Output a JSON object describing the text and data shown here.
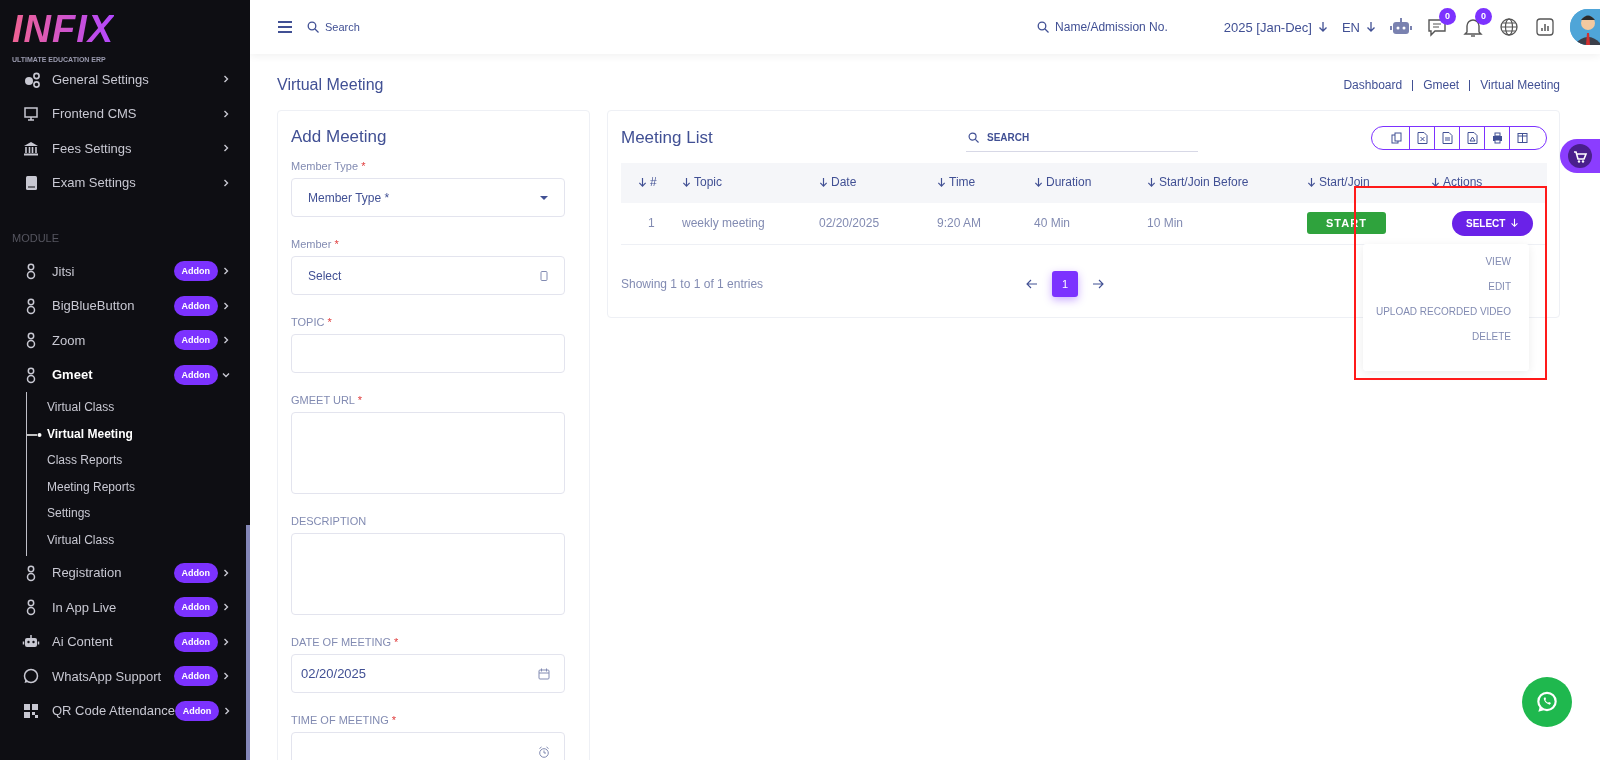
{
  "brand": {
    "logo": "INFIX",
    "tagline": "ULTIMATE EDUCATION ERP"
  },
  "sidebar": {
    "items": [
      {
        "label": "General Settings",
        "expanded": false
      },
      {
        "label": "Frontend CMS",
        "expanded": false
      },
      {
        "label": "Fees Settings",
        "expanded": false
      },
      {
        "label": "Exam Settings",
        "expanded": false
      }
    ],
    "section": "MODULE",
    "modules": [
      {
        "label": "Jitsi",
        "badge": "Addon",
        "expanded": false
      },
      {
        "label": "BigBlueButton",
        "badge": "Addon",
        "expanded": false
      },
      {
        "label": "Zoom",
        "badge": "Addon",
        "expanded": false
      },
      {
        "label": "Gmeet",
        "badge": "Addon",
        "expanded": true,
        "children": [
          {
            "label": "Virtual Class",
            "selected": false
          },
          {
            "label": "Virtual Meeting",
            "selected": true
          },
          {
            "label": "Class Reports",
            "selected": false
          },
          {
            "label": "Meeting Reports",
            "selected": false
          },
          {
            "label": "Settings",
            "selected": false
          },
          {
            "label": "Virtual Class",
            "selected": false
          }
        ]
      },
      {
        "label": "Registration",
        "badge": "Addon",
        "expanded": false
      },
      {
        "label": "In App Live",
        "badge": "Addon",
        "expanded": false
      },
      {
        "label": "Ai Content",
        "badge": "Addon",
        "expanded": false
      },
      {
        "label": "WhatsApp Support",
        "badge": "Addon",
        "expanded": false
      },
      {
        "label": "QR Code Attendance",
        "badge": "Addon",
        "expanded": false
      }
    ]
  },
  "header": {
    "search_placeholder": "Search",
    "student_search_placeholder": "Name/Admission No.",
    "session": "2025 [Jan-Dec]",
    "language": "EN",
    "messages_count": "0",
    "notifications_count": "0"
  },
  "page": {
    "title": "Virtual Meeting",
    "breadcrumb": [
      "Dashboard",
      "Gmeet",
      "Virtual Meeting"
    ]
  },
  "form": {
    "title": "Add Meeting",
    "fields": [
      {
        "kind": "select",
        "label": "Member Type",
        "mark": "*",
        "placeholder": "Member Type *"
      },
      {
        "kind": "picker",
        "label": "Member",
        "mark": "*",
        "placeholder": "Select"
      },
      {
        "kind": "text",
        "label": "TOPIC",
        "mark": "*"
      },
      {
        "kind": "textarea",
        "label": "GMEET URL",
        "mark": "*"
      },
      {
        "kind": "textarea",
        "label": "DESCRIPTION"
      },
      {
        "kind": "date",
        "label": "DATE OF MEETING",
        "mark": "*",
        "value": "02/20/2025"
      },
      {
        "kind": "time",
        "label": "TIME OF MEETING",
        "mark": "*"
      }
    ]
  },
  "list": {
    "title": "Meeting List",
    "search_placeholder": "SEARCH",
    "columns": [
      "#",
      "Topic",
      "Date",
      "Time",
      "Duration",
      "Start/Join Before",
      "Start/Join",
      "Actions"
    ],
    "rows": [
      {
        "cells": [
          "1",
          "weekly meeting",
          "02/20/2025",
          "9:20 AM",
          "40 Min",
          "10 Min"
        ],
        "start_label": "START",
        "action_label": "SELECT",
        "menu_open": true
      }
    ],
    "menu": [
      "VIEW",
      "EDIT",
      "UPLOAD RECORDED VIDEO",
      "DELETE"
    ],
    "highlighted": true,
    "info": "Showing 1 to 1 of 1 entries",
    "pages": [
      {
        "label": "1",
        "selected": true
      }
    ]
  }
}
